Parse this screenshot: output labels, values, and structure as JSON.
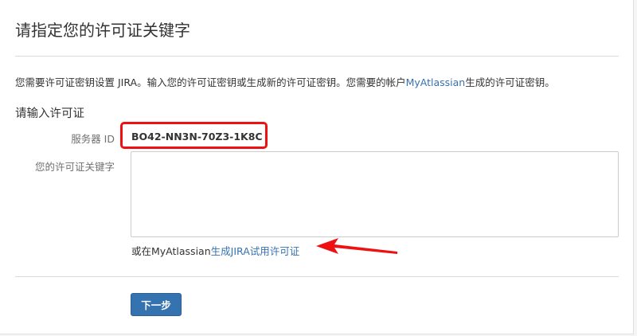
{
  "page": {
    "title": "请指定您的许可证关键字"
  },
  "intro": {
    "text_before": "您需要许可证密钥设置 JIRA。输入您的许可证密钥或生成新的许可证密钥。您需要的帐户",
    "link_label": "MyAtlassian",
    "text_after": "生成的许可证密钥。"
  },
  "form": {
    "section_title": "请输入许可证",
    "server_id_label": "服务器 ID",
    "server_id_value": "BO42-NN3N-70Z3-1K8C",
    "license_label": "您的许可证关键字",
    "license_value": "",
    "trial_prefix": "或在MyAtlassian",
    "trial_link_label": "生成JIRA试用许可证"
  },
  "actions": {
    "next_label": "下一步"
  },
  "colors": {
    "accent": "#3572b0",
    "annotation": "#ee1111"
  }
}
